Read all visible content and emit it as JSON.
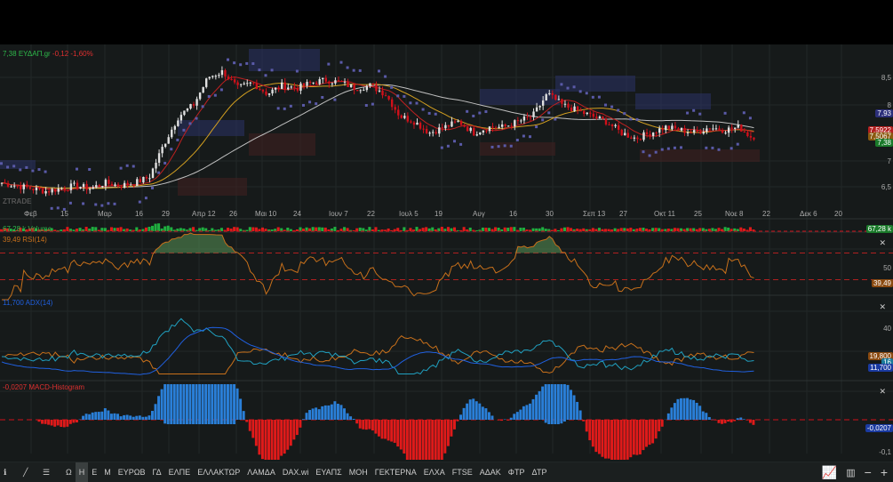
{
  "header": {
    "price": "7,38",
    "symbol": "ΕΥΔΑΠ.gr",
    "change": "-0,12",
    "change_pct": "-1,60%",
    "watermark": "ZTRADE"
  },
  "price_axis": [
    "8,5",
    "8",
    "7",
    "6,5"
  ],
  "price_tags": [
    {
      "v": "7,93",
      "c": "#2c2f7a"
    },
    {
      "v": "7,5922",
      "c": "#b32020"
    },
    {
      "v": "7,5067",
      "c": "#8a5a10"
    },
    {
      "v": "7,38",
      "c": "#1a7a2a"
    }
  ],
  "date_axis": [
    "Φεβ",
    "15",
    "Μαρ",
    "16",
    "29",
    "Απρ 12",
    "26",
    "Μαι 10",
    "24",
    "Ιουν 7",
    "22",
    "Ιουλ 5",
    "19",
    "Αυγ",
    "16",
    "30",
    "Σεπ 13",
    "27",
    "Οκτ 11",
    "25",
    "Νοε 8",
    "22",
    "Δεκ 6",
    "20"
  ],
  "volume": {
    "label": "67,28 k Volume",
    "tag": "67,28 k"
  },
  "rsi": {
    "label": "39,49 RSI(14)",
    "tag": "39,49",
    "axis": "50"
  },
  "adx": {
    "label": "11,700 ADX(14)",
    "tags": [
      "19,800",
      "16",
      "11,700"
    ],
    "axis": [
      "40",
      "20"
    ]
  },
  "macd": {
    "label": "-0,0207 MACD-Histogram",
    "tag": "-0,0207",
    "axis": "-0,1"
  },
  "toolbar": {
    "items": [
      "Ω",
      "Η",
      "Ε",
      "Μ",
      "ΕΥΡΩΒ",
      "ΓΔ",
      "ΕΛΠΕ",
      "ΕΛΛΑΚΤΩΡ",
      "ΛΑΜΔΑ",
      "DAX.wi",
      "ΕΥΑΠΣ",
      "ΜΟΗ",
      "ΓΕΚΤΕΡΝΑ",
      "ΕΛΧΑ",
      "FTSE",
      "ΑΔΑΚ",
      "ΦΤΡ",
      "ΔΤΡ"
    ],
    "active": "Η",
    "right": [
      "−",
      "+"
    ]
  },
  "colors": {
    "up": "#e0e0e0",
    "down": "#d0101a",
    "rsi": "#c8701a",
    "adx": "#2060e0",
    "di_plus": "#20a0c0",
    "di_minus": "#c8701a",
    "macd_up": "#2a7fd8",
    "macd_down": "#e01a1a",
    "vol_up": "#20b040",
    "vol_down": "#e01a1a"
  },
  "chart_data": {
    "type": "candlestick",
    "closes": [
      6.6,
      6.55,
      6.5,
      6.45,
      6.5,
      6.55,
      6.5,
      6.6,
      6.55,
      6.6,
      6.7,
      7.3,
      7.8,
      8.0,
      8.5,
      8.6,
      8.3,
      8.4,
      8.2,
      8.35,
      8.3,
      8.4,
      8.45,
      8.4,
      8.3,
      8.35,
      8.2,
      7.8,
      7.7,
      7.5,
      7.6,
      7.7,
      7.5,
      7.6,
      7.6,
      7.7,
      7.8,
      8.2,
      8.0,
      7.9,
      7.8,
      7.7,
      7.5,
      7.4,
      7.5,
      7.6,
      7.55,
      7.5,
      7.6,
      7.55,
      7.6,
      7.38
    ]
  }
}
